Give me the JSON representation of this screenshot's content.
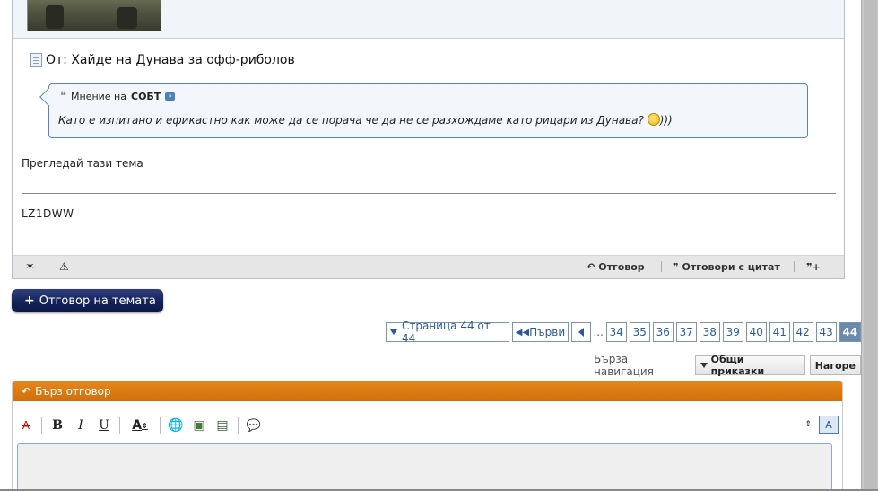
{
  "post": {
    "title": "От: Хайде на Дунава за офф-риболов",
    "quote": {
      "prefix": "Мнение на",
      "author": "СОБТ",
      "text": "Като е изпитано и ефикастно как може да се порача че да не се разхождаме като рицари из Дунава?",
      "suffix": ")))"
    },
    "view_topic": "Прегледай тази тема",
    "signature": "LZ1DWW",
    "footer": {
      "reply": "Отговор",
      "reply_quote": "Отговори с цитат"
    }
  },
  "reply_button": "Отговор на темата",
  "pagination": {
    "label": "Страница 44 от 44",
    "first": "Първи",
    "ellipsis": "...",
    "pages": [
      "34",
      "35",
      "36",
      "37",
      "38",
      "39",
      "40",
      "41",
      "42",
      "43"
    ],
    "current": "44"
  },
  "quick_nav": {
    "label": "Бърза навигация",
    "select": "Общи приказки",
    "top": "Нагоре"
  },
  "quick_reply": {
    "title": "Бърз отговор"
  },
  "colors": {
    "accent_orange": "#d8760f",
    "link_blue": "#2a5a9a",
    "reply_button": "#13215a"
  }
}
